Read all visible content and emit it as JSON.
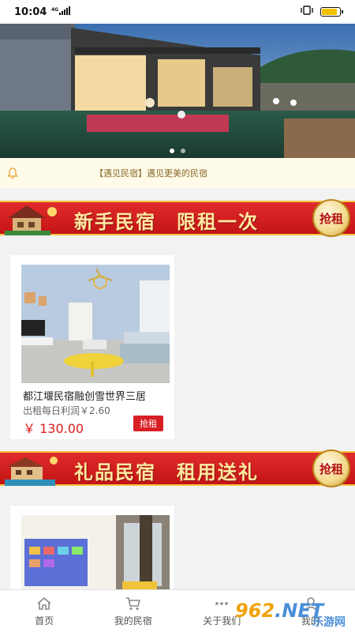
{
  "status_bar": {
    "time": "10:04",
    "network": "4G"
  },
  "banner": {
    "dot_count": 2,
    "active_dot": 0
  },
  "notice": {
    "text": "【遇见民宿】遇见更美的民宿"
  },
  "promos": [
    {
      "title": "新手民宿　限租一次",
      "button": "抢租"
    },
    {
      "title": "礼品民宿　租用送礼",
      "button": "抢租"
    }
  ],
  "listings": [
    {
      "name": "都江堰民宿融创雪世界三居",
      "profit": "出租每日利润￥2.60",
      "price": "￥ 130.00",
      "button": "抢租"
    }
  ],
  "tabbar": {
    "items": [
      {
        "label": "首页",
        "icon": "home-icon"
      },
      {
        "label": "我的民宿",
        "icon": "cart-icon"
      },
      {
        "label": "关于我们",
        "icon": "more-dots-icon"
      },
      {
        "label": "我的",
        "icon": "user-icon"
      }
    ]
  },
  "watermark": {
    "brand": "962",
    "domain": ".NET",
    "site": "乐游网"
  },
  "colors": {
    "accent_red": "#d81e25",
    "price_red": "#e01b1b",
    "notice_bg": "#fffbe9",
    "gold": "#f4c343"
  }
}
